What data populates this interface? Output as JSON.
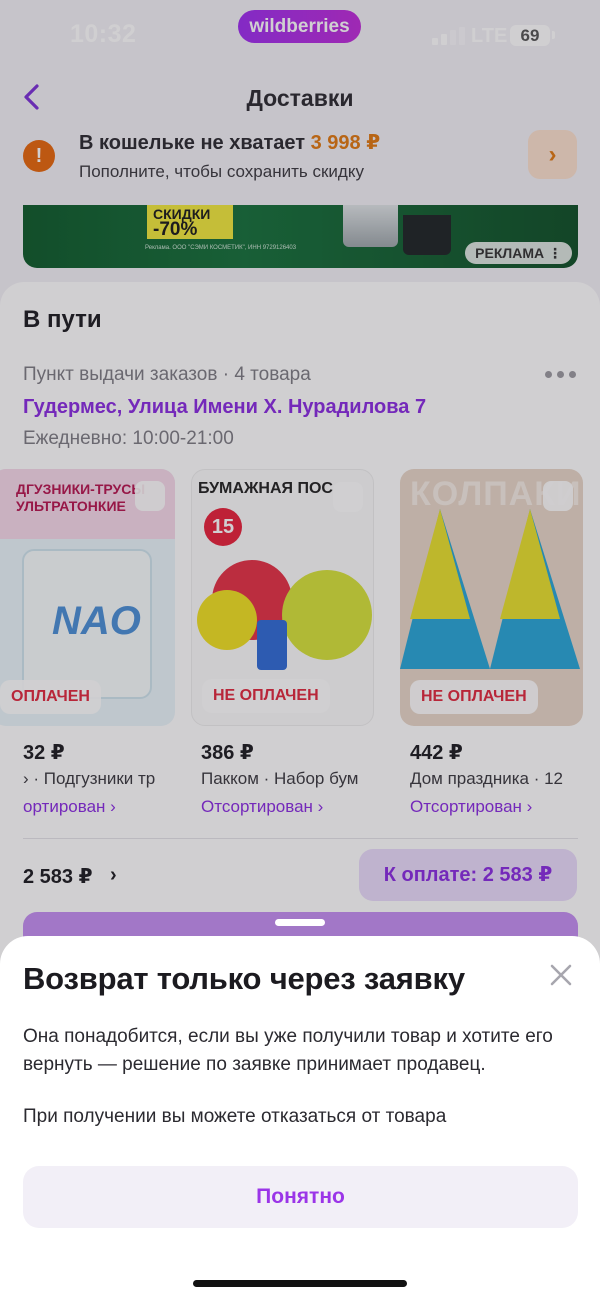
{
  "status_bar": {
    "time": "10:32",
    "brand": "wildberries",
    "network": "LTE",
    "battery": "69"
  },
  "nav": {
    "title": "Доставки"
  },
  "wallet": {
    "title_prefix": "В кошельке не хватает ",
    "amount": "3 998 ₽",
    "subtitle": "Пополните, чтобы сохранить скидку"
  },
  "banner": {
    "sale_top": "СКИДКИ",
    "sale_value": "-70%",
    "legal": "Реклама. ООО \"СЭМИ КОСМЕТИК\", ИНН 9729126403",
    "ad_label": "РЕКЛАМА"
  },
  "delivery": {
    "section_title": "В пути",
    "pickup": "Пункт выдачи заказов · 4 товара",
    "address": "Гудермес, Улица Имени Х. Нурадилова 7",
    "hours": "Ежедневно: 10:00-21:00",
    "products": [
      {
        "price": "32 ₽",
        "name": "› · Подгузники тр",
        "status": "ОПЛАЧЕН",
        "sorted": "ортирован ›",
        "img_text": "ДГУЗНИКИ-ТРУСЫ УЛЬТРАТОНКИЕ"
      },
      {
        "price": "386 ₽",
        "name": "Пакком · Набор бум",
        "status": "НЕ ОПЛАЧЕН",
        "sorted": "Отсортирован ›",
        "img_text": "БУМАЖНАЯ ПОС"
      },
      {
        "price": "442 ₽",
        "name": "Дом праздника · 12",
        "status": "НЕ ОПЛАЧЕН",
        "sorted": "Отсортирован ›",
        "img_text": "КОЛПАКИ"
      }
    ],
    "total": "2 583 ₽",
    "pay_button": "К оплате: 2 583 ₽"
  },
  "sheet": {
    "title": "Возврат только через заявку",
    "text": "Она понадобится, если вы уже получили товар и хотите его вернуть — решение по заявке принимает продавец.",
    "text2": "При получении вы можете отказаться от товара",
    "button": "Понятно"
  }
}
